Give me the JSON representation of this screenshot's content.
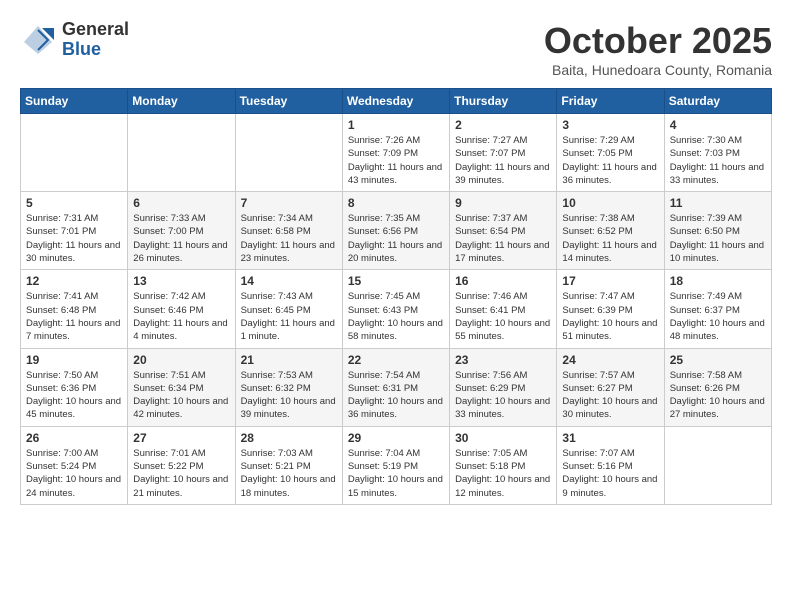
{
  "logo": {
    "general": "General",
    "blue": "Blue"
  },
  "header": {
    "month": "October 2025",
    "location": "Baita, Hunedoara County, Romania"
  },
  "weekdays": [
    "Sunday",
    "Monday",
    "Tuesday",
    "Wednesday",
    "Thursday",
    "Friday",
    "Saturday"
  ],
  "weeks": [
    [
      {
        "day": "",
        "sunrise": "",
        "sunset": "",
        "daylight": ""
      },
      {
        "day": "",
        "sunrise": "",
        "sunset": "",
        "daylight": ""
      },
      {
        "day": "",
        "sunrise": "",
        "sunset": "",
        "daylight": ""
      },
      {
        "day": "1",
        "sunrise": "Sunrise: 7:26 AM",
        "sunset": "Sunset: 7:09 PM",
        "daylight": "Daylight: 11 hours and 43 minutes."
      },
      {
        "day": "2",
        "sunrise": "Sunrise: 7:27 AM",
        "sunset": "Sunset: 7:07 PM",
        "daylight": "Daylight: 11 hours and 39 minutes."
      },
      {
        "day": "3",
        "sunrise": "Sunrise: 7:29 AM",
        "sunset": "Sunset: 7:05 PM",
        "daylight": "Daylight: 11 hours and 36 minutes."
      },
      {
        "day": "4",
        "sunrise": "Sunrise: 7:30 AM",
        "sunset": "Sunset: 7:03 PM",
        "daylight": "Daylight: 11 hours and 33 minutes."
      }
    ],
    [
      {
        "day": "5",
        "sunrise": "Sunrise: 7:31 AM",
        "sunset": "Sunset: 7:01 PM",
        "daylight": "Daylight: 11 hours and 30 minutes."
      },
      {
        "day": "6",
        "sunrise": "Sunrise: 7:33 AM",
        "sunset": "Sunset: 7:00 PM",
        "daylight": "Daylight: 11 hours and 26 minutes."
      },
      {
        "day": "7",
        "sunrise": "Sunrise: 7:34 AM",
        "sunset": "Sunset: 6:58 PM",
        "daylight": "Daylight: 11 hours and 23 minutes."
      },
      {
        "day": "8",
        "sunrise": "Sunrise: 7:35 AM",
        "sunset": "Sunset: 6:56 PM",
        "daylight": "Daylight: 11 hours and 20 minutes."
      },
      {
        "day": "9",
        "sunrise": "Sunrise: 7:37 AM",
        "sunset": "Sunset: 6:54 PM",
        "daylight": "Daylight: 11 hours and 17 minutes."
      },
      {
        "day": "10",
        "sunrise": "Sunrise: 7:38 AM",
        "sunset": "Sunset: 6:52 PM",
        "daylight": "Daylight: 11 hours and 14 minutes."
      },
      {
        "day": "11",
        "sunrise": "Sunrise: 7:39 AM",
        "sunset": "Sunset: 6:50 PM",
        "daylight": "Daylight: 11 hours and 10 minutes."
      }
    ],
    [
      {
        "day": "12",
        "sunrise": "Sunrise: 7:41 AM",
        "sunset": "Sunset: 6:48 PM",
        "daylight": "Daylight: 11 hours and 7 minutes."
      },
      {
        "day": "13",
        "sunrise": "Sunrise: 7:42 AM",
        "sunset": "Sunset: 6:46 PM",
        "daylight": "Daylight: 11 hours and 4 minutes."
      },
      {
        "day": "14",
        "sunrise": "Sunrise: 7:43 AM",
        "sunset": "Sunset: 6:45 PM",
        "daylight": "Daylight: 11 hours and 1 minute."
      },
      {
        "day": "15",
        "sunrise": "Sunrise: 7:45 AM",
        "sunset": "Sunset: 6:43 PM",
        "daylight": "Daylight: 10 hours and 58 minutes."
      },
      {
        "day": "16",
        "sunrise": "Sunrise: 7:46 AM",
        "sunset": "Sunset: 6:41 PM",
        "daylight": "Daylight: 10 hours and 55 minutes."
      },
      {
        "day": "17",
        "sunrise": "Sunrise: 7:47 AM",
        "sunset": "Sunset: 6:39 PM",
        "daylight": "Daylight: 10 hours and 51 minutes."
      },
      {
        "day": "18",
        "sunrise": "Sunrise: 7:49 AM",
        "sunset": "Sunset: 6:37 PM",
        "daylight": "Daylight: 10 hours and 48 minutes."
      }
    ],
    [
      {
        "day": "19",
        "sunrise": "Sunrise: 7:50 AM",
        "sunset": "Sunset: 6:36 PM",
        "daylight": "Daylight: 10 hours and 45 minutes."
      },
      {
        "day": "20",
        "sunrise": "Sunrise: 7:51 AM",
        "sunset": "Sunset: 6:34 PM",
        "daylight": "Daylight: 10 hours and 42 minutes."
      },
      {
        "day": "21",
        "sunrise": "Sunrise: 7:53 AM",
        "sunset": "Sunset: 6:32 PM",
        "daylight": "Daylight: 10 hours and 39 minutes."
      },
      {
        "day": "22",
        "sunrise": "Sunrise: 7:54 AM",
        "sunset": "Sunset: 6:31 PM",
        "daylight": "Daylight: 10 hours and 36 minutes."
      },
      {
        "day": "23",
        "sunrise": "Sunrise: 7:56 AM",
        "sunset": "Sunset: 6:29 PM",
        "daylight": "Daylight: 10 hours and 33 minutes."
      },
      {
        "day": "24",
        "sunrise": "Sunrise: 7:57 AM",
        "sunset": "Sunset: 6:27 PM",
        "daylight": "Daylight: 10 hours and 30 minutes."
      },
      {
        "day": "25",
        "sunrise": "Sunrise: 7:58 AM",
        "sunset": "Sunset: 6:26 PM",
        "daylight": "Daylight: 10 hours and 27 minutes."
      }
    ],
    [
      {
        "day": "26",
        "sunrise": "Sunrise: 7:00 AM",
        "sunset": "Sunset: 5:24 PM",
        "daylight": "Daylight: 10 hours and 24 minutes."
      },
      {
        "day": "27",
        "sunrise": "Sunrise: 7:01 AM",
        "sunset": "Sunset: 5:22 PM",
        "daylight": "Daylight: 10 hours and 21 minutes."
      },
      {
        "day": "28",
        "sunrise": "Sunrise: 7:03 AM",
        "sunset": "Sunset: 5:21 PM",
        "daylight": "Daylight: 10 hours and 18 minutes."
      },
      {
        "day": "29",
        "sunrise": "Sunrise: 7:04 AM",
        "sunset": "Sunset: 5:19 PM",
        "daylight": "Daylight: 10 hours and 15 minutes."
      },
      {
        "day": "30",
        "sunrise": "Sunrise: 7:05 AM",
        "sunset": "Sunset: 5:18 PM",
        "daylight": "Daylight: 10 hours and 12 minutes."
      },
      {
        "day": "31",
        "sunrise": "Sunrise: 7:07 AM",
        "sunset": "Sunset: 5:16 PM",
        "daylight": "Daylight: 10 hours and 9 minutes."
      },
      {
        "day": "",
        "sunrise": "",
        "sunset": "",
        "daylight": ""
      }
    ]
  ]
}
